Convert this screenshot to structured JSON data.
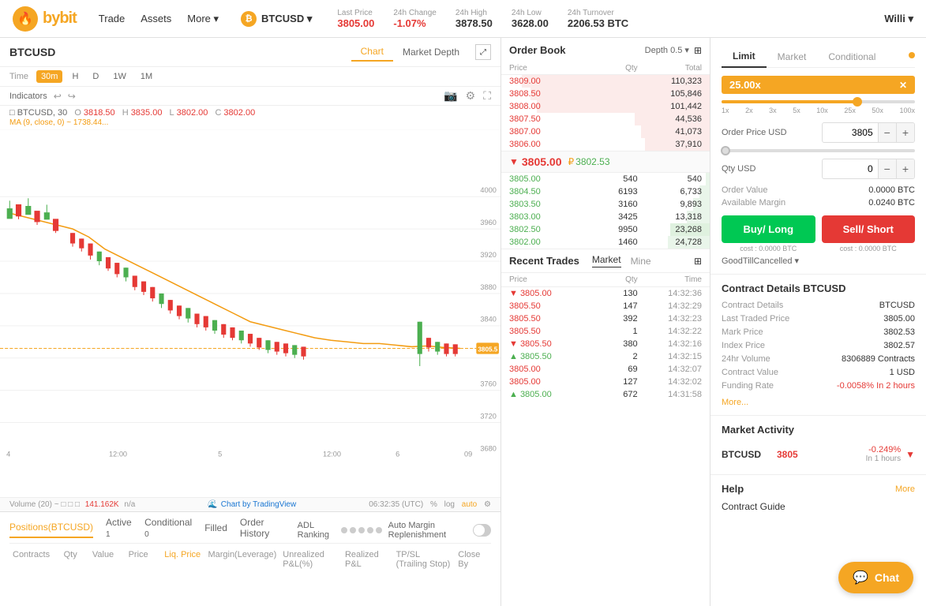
{
  "header": {
    "logo_text": "bybit",
    "nav": [
      "Trade",
      "Assets",
      "More ▾"
    ],
    "pair": "BTCUSD ▾",
    "pair_icon": "₿",
    "stats": {
      "last_price_label": "Last Price",
      "last_price": "3805.00",
      "change_label": "24h Change",
      "change": "-1.07%",
      "high_label": "24h High",
      "high": "3878.50",
      "low_label": "24h Low",
      "low": "3628.00",
      "turnover_label": "24h Turnover",
      "turnover": "2206.53 BTC"
    },
    "user": "Willi ▾"
  },
  "chart": {
    "title": "BTCUSD",
    "tabs": [
      "Chart",
      "Market Depth"
    ],
    "time_label": "Time",
    "time_options": [
      "30m",
      "H",
      "D",
      "1W",
      "1M"
    ],
    "active_time": "30m",
    "indicators_label": "Indicators",
    "ohlc": {
      "symbol": "BTCUSD, 30",
      "open": "3818.50",
      "high": "3835.00",
      "low": "3802.00",
      "close": "3802.00",
      "ma": "MA (9, close, 0) ~",
      "ma_value": "1738.44..."
    },
    "current_price": "3805.50",
    "volume_label": "Volume (20) ~",
    "volume_value": "141.162K",
    "volume_na": "n/a",
    "tradingview": "Chart by TradingView",
    "time_display": "06:32:35 (UTC)",
    "footer_opts": [
      "%",
      "log",
      "auto"
    ]
  },
  "positions": {
    "tabs": [
      {
        "label": "Positions(BTCUSD)",
        "badge": ""
      },
      {
        "label": "Active",
        "badge": "1"
      },
      {
        "label": "Conditional",
        "badge": "0"
      },
      {
        "label": "Filled",
        "badge": ""
      },
      {
        "label": "Order History",
        "badge": ""
      }
    ],
    "adl_label": "ADL Ranking",
    "amr_label": "Auto Margin Replenishment",
    "columns": [
      "Contracts",
      "Qty",
      "Value",
      "Price",
      "Liq. Price",
      "Margin(Leverage)",
      "Unrealized P&L(%)",
      "Realized P&L",
      "TP/SL (Trailing Stop)",
      "Close By"
    ]
  },
  "orderbook": {
    "title": "Order Book",
    "depth_label": "Depth 0.5 ▾",
    "cols": [
      "Price",
      "Qty",
      "Total"
    ],
    "sell_orders": [
      {
        "price": "3809.00",
        "qty": "",
        "total": "110,323",
        "bar_pct": 90
      },
      {
        "price": "3808.50",
        "qty": "",
        "total": "105,846",
        "bar_pct": 86
      },
      {
        "price": "3808.00",
        "qty": "",
        "total": "101,442",
        "bar_pct": 83
      },
      {
        "price": "3807.50",
        "qty": "",
        "total": "44,536",
        "bar_pct": 36
      },
      {
        "price": "3807.00",
        "qty": "",
        "total": "41,073",
        "bar_pct": 33
      },
      {
        "price": "3806.00",
        "qty": "",
        "total": "37,910",
        "bar_pct": 31
      }
    ],
    "spread_price": "3805.00",
    "spread_mark": "₽3802.53",
    "buy_orders": [
      {
        "price": "3805.00",
        "qty": "540",
        "total": "540",
        "bar_pct": 2
      },
      {
        "price": "3804.50",
        "qty": "6193",
        "total": "6,733",
        "bar_pct": 5
      },
      {
        "price": "3803.50",
        "qty": "3160",
        "total": "9,893",
        "bar_pct": 8
      },
      {
        "price": "3803.00",
        "qty": "3425",
        "total": "13,318",
        "bar_pct": 11
      },
      {
        "price": "3802.50",
        "qty": "9950",
        "total": "23,268",
        "bar_pct": 19
      },
      {
        "price": "3802.00",
        "qty": "1460",
        "total": "24,728",
        "bar_pct": 20
      }
    ]
  },
  "trades": {
    "title": "Recent Trades",
    "tabs": [
      "Market",
      "Mine"
    ],
    "cols": [
      "Price",
      "Qty",
      "Time"
    ],
    "rows": [
      {
        "price": "3805.00",
        "dir": "down",
        "qty": "130",
        "time": "14:32:36"
      },
      {
        "price": "3805.50",
        "dir": "sell",
        "qty": "147",
        "time": "14:32:29"
      },
      {
        "price": "3805.50",
        "dir": "sell",
        "qty": "392",
        "time": "14:32:23"
      },
      {
        "price": "3805.50",
        "dir": "sell",
        "qty": "1",
        "time": "14:32:22"
      },
      {
        "price": "3805.50",
        "dir": "down",
        "qty": "380",
        "time": "14:32:16"
      },
      {
        "price": "3805.50",
        "dir": "up",
        "qty": "2",
        "time": "14:32:15"
      },
      {
        "price": "3805.00",
        "dir": "sell",
        "qty": "69",
        "time": "14:32:07"
      },
      {
        "price": "3805.00",
        "dir": "sell",
        "qty": "127",
        "time": "14:32:02"
      },
      {
        "price": "3805.00",
        "dir": "up",
        "qty": "672",
        "time": "14:31:58"
      }
    ]
  },
  "order_form": {
    "tabs": [
      "Limit",
      "Market",
      "Conditional"
    ],
    "active_tab": "Limit",
    "leverage_value": "25.00x",
    "leverage_marks": [
      "1x",
      "2x",
      "3x",
      "5x",
      "10x",
      "25x",
      "50x",
      "100x"
    ],
    "order_price_label": "Order Price USD",
    "order_price_value": "3805",
    "qty_label": "Qty USD",
    "qty_value": "0",
    "order_value_label": "Order Value",
    "order_value": "0.0000 BTC",
    "available_margin_label": "Available Margin",
    "available_margin": "0.0240 BTC",
    "buy_label": "Buy/ Long",
    "sell_label": "Sell/ Short",
    "buy_cost": "cost : 0.0000 BTC",
    "sell_cost": "cost : 0.0000 BTC",
    "good_till": "GoodTillCancelled ▾"
  },
  "contract_details": {
    "title": "Contract Details BTCUSD",
    "rows": [
      {
        "label": "Contract Details",
        "value": "BTCUSD"
      },
      {
        "label": "Last Traded Price",
        "value": "3805.00"
      },
      {
        "label": "Mark Price",
        "value": "3802.53"
      },
      {
        "label": "Index Price",
        "value": "3802.57"
      },
      {
        "label": "24hr Volume",
        "value": "8306889 Contracts"
      },
      {
        "label": "Contract Value",
        "value": "1 USD"
      },
      {
        "label": "Funding Rate",
        "value": "-0.0058% In 2 hours",
        "red": true
      }
    ],
    "more_label": "More..."
  },
  "market_activity": {
    "title": "Market Activity",
    "rows": [
      {
        "pair": "BTCUSD",
        "price": "3805",
        "change": "-0.249%",
        "sub": "In 1 hours",
        "dir": "down"
      }
    ]
  },
  "help": {
    "title": "Help",
    "more_label": "More",
    "links": [
      "Contract Guide"
    ]
  },
  "chat_label": "Chat"
}
